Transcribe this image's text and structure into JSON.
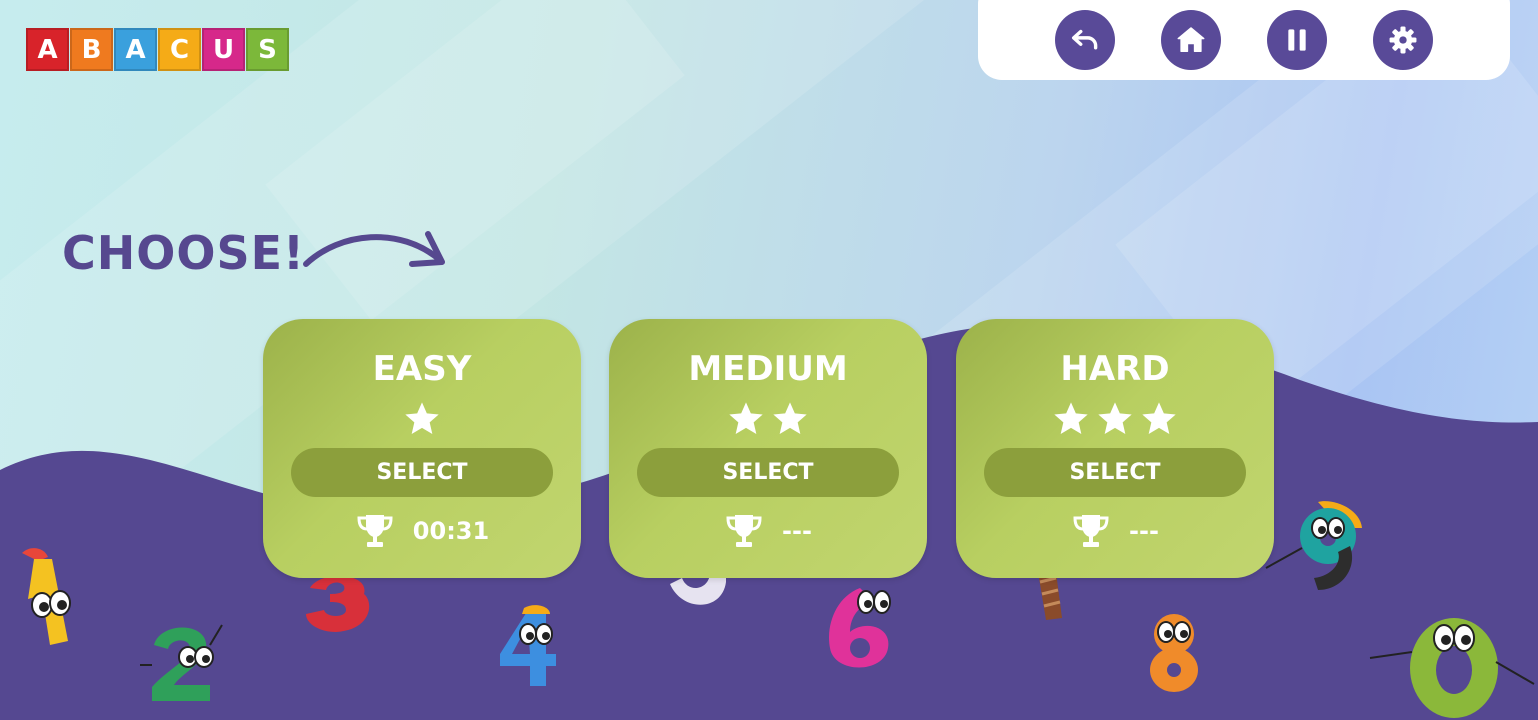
{
  "logo": {
    "letters": [
      {
        "char": "A",
        "color": "#d8232a"
      },
      {
        "char": "B",
        "color": "#ef7a1f"
      },
      {
        "char": "A",
        "color": "#3aa0dd"
      },
      {
        "char": "C",
        "color": "#f5ab17"
      },
      {
        "char": "U",
        "color": "#d6288a"
      },
      {
        "char": "S",
        "color": "#7cb83a"
      }
    ]
  },
  "toolbar": {
    "buttons": [
      {
        "name": "undo",
        "icon": "undo-icon"
      },
      {
        "name": "home",
        "icon": "home-icon"
      },
      {
        "name": "pause",
        "icon": "pause-icon"
      },
      {
        "name": "settings",
        "icon": "gear-icon"
      }
    ],
    "button_color": "#594a98"
  },
  "heading": {
    "text": "CHOOSE!"
  },
  "levels": [
    {
      "name": "EASY",
      "stars": 3,
      "filled": 1,
      "select_label": "SELECT",
      "best_time": "00:31",
      "trophy_icon": "trophy-icon"
    },
    {
      "name": "MEDIUM",
      "stars": 3,
      "filled": 2,
      "select_label": "SELECT",
      "best_time": "---",
      "trophy_icon": "trophy-icon"
    },
    {
      "name": "HARD",
      "stars": 3,
      "filled": 3,
      "select_label": "SELECT",
      "best_time": "---",
      "trophy_icon": "trophy-icon"
    }
  ],
  "colors": {
    "accent": "#594a98",
    "card": "#b8cf61",
    "button": "#8c9f3c",
    "wave": "#554891"
  },
  "characters": [
    {
      "glyph": "1",
      "color": "#f4c221"
    },
    {
      "glyph": "2",
      "color": "#2fa05a"
    },
    {
      "glyph": "3",
      "color": "#d8303a"
    },
    {
      "glyph": "4",
      "color": "#3d8fe0"
    },
    {
      "glyph": "5",
      "color": "#e6e3f0"
    },
    {
      "glyph": "6",
      "color": "#e0329a"
    },
    {
      "glyph": "7",
      "color": "#8a4b2a"
    },
    {
      "glyph": "8",
      "color": "#f08b2a"
    },
    {
      "glyph": "9",
      "color": "#1fa3a0"
    },
    {
      "glyph": "0",
      "color": "#8bb83a"
    }
  ]
}
